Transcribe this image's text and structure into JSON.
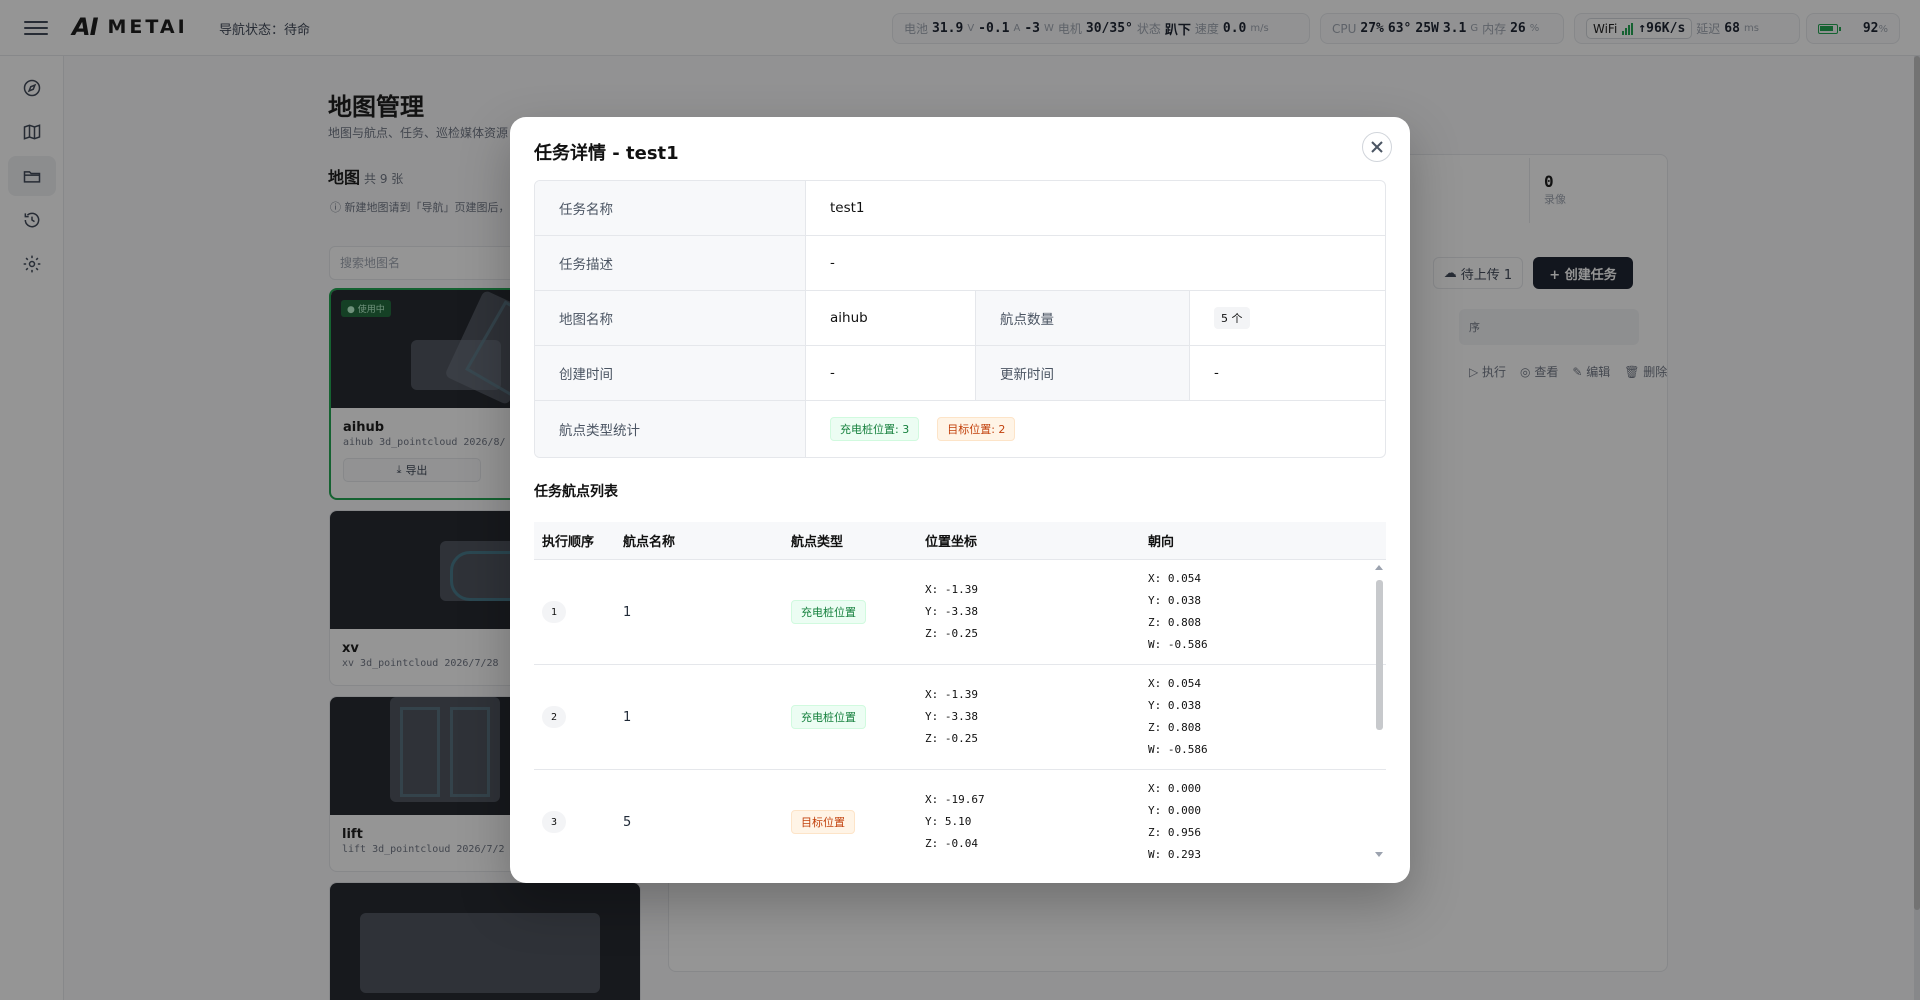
{
  "header": {
    "logo_mark": "AI",
    "logo_text": "METAI",
    "nav_status": "导航状态：待命",
    "power": {
      "battery_label": "电池",
      "voltage": "31.9",
      "voltage_unit": "V",
      "current": "-0.1",
      "current_unit": "A",
      "watts": "-3",
      "watts_unit": "W",
      "motor_label": "电机",
      "motor": "30/35°",
      "state_label": "状态",
      "state": "趴下",
      "speed_label": "速度",
      "speed": "0.0",
      "speed_unit": "m/s"
    },
    "cpu": {
      "label": "CPU",
      "usage": "27%",
      "temp": "63°",
      "power": "25W",
      "mem_gb": "3.1",
      "mem_unit": "G",
      "mem_label": "内存",
      "mem_pct": "26",
      "mem_pct_unit": "%"
    },
    "net": {
      "wifi_label": "WiFi",
      "speed": "↑96K/s",
      "latency_label": "延迟",
      "latency": "68",
      "latency_unit": "ms"
    },
    "battery": {
      "percent": "92",
      "percent_unit": "%"
    }
  },
  "sidebar": {
    "items": [
      "compass-icon",
      "map-icon",
      "folder-icon",
      "history-icon",
      "settings-icon"
    ],
    "active_index": 2
  },
  "page": {
    "title": "地图管理",
    "subtitle": "地图与航点、任务、巡检媒体资源",
    "maps_heading": "地图",
    "maps_count": "共 9 张",
    "maps_hint": "ⓘ 新建地图请到「导航」页建图后，可导入 .zip 包",
    "search_placeholder": "搜索地图名",
    "map_cards": [
      {
        "name": "aihub",
        "meta": "aihub   3d_pointcloud   2026/8/",
        "badge": "● 使用中",
        "export": "导出"
      },
      {
        "name": "xv",
        "meta": "xv   3d_pointcloud   2026/7/28"
      },
      {
        "name": "lift",
        "meta": "lift   3d_pointcloud   2026/7/2"
      },
      {
        "name": "",
        "meta": ""
      }
    ],
    "stat": {
      "value": "0",
      "label": "录像"
    },
    "upload_button": "待上传 1",
    "create_button": "+ 创建任务",
    "task_row_text": "序",
    "row_actions": [
      "▷ 执行",
      "◎ 查看",
      "✎ 编辑",
      "🗑 删除"
    ]
  },
  "modal": {
    "title": "任务详情 - test1",
    "info": {
      "task_name_label": "任务名称",
      "task_name": "test1",
      "task_desc_label": "任务描述",
      "task_desc": "-",
      "map_name_label": "地图名称",
      "map_name": "aihub",
      "wp_count_label": "航点数量",
      "wp_count": "5 个",
      "created_label": "创建时间",
      "created": "-",
      "updated_label": "更新时间",
      "updated": "-",
      "type_stats_label": "航点类型统计",
      "type_stats": [
        {
          "text": "充电桩位置: 3",
          "color": "green"
        },
        {
          "text": "目标位置: 2",
          "color": "orange"
        }
      ]
    },
    "list_title": "任务航点列表",
    "columns": [
      "执行顺序",
      "航点名称",
      "航点类型",
      "位置坐标",
      "朝向"
    ],
    "waypoints": [
      {
        "order": "1",
        "name": "1",
        "type": "充电桩位置",
        "type_color": "green",
        "pos": [
          "X: -1.39",
          "Y: -3.38",
          "Z: -0.25"
        ],
        "ori": [
          "X: 0.054",
          "Y: 0.038",
          "Z: 0.808",
          "W: -0.586"
        ]
      },
      {
        "order": "2",
        "name": "1",
        "type": "充电桩位置",
        "type_color": "green",
        "pos": [
          "X: -1.39",
          "Y: -3.38",
          "Z: -0.25"
        ],
        "ori": [
          "X: 0.054",
          "Y: 0.038",
          "Z: 0.808",
          "W: -0.586"
        ]
      },
      {
        "order": "3",
        "name": "5",
        "type": "目标位置",
        "type_color": "orange",
        "pos": [
          "X: -19.67",
          "Y: 5.10",
          "Z: -0.04"
        ],
        "ori": [
          "X: 0.000",
          "Y: 0.000",
          "Z: 0.956",
          "W: 0.293"
        ]
      }
    ]
  }
}
